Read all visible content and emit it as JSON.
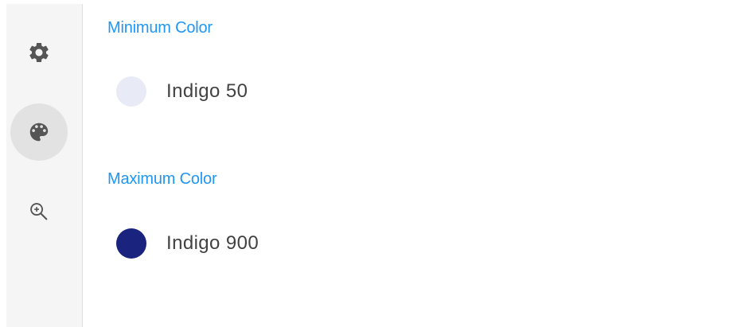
{
  "sidebar": {
    "items": [
      {
        "icon": "gear-icon",
        "selected": false
      },
      {
        "icon": "palette-icon",
        "selected": true
      },
      {
        "icon": "zoom-in-icon",
        "selected": false
      }
    ]
  },
  "min_color": {
    "title": "Minimum Color",
    "name": "Indigo 50",
    "hex": "#e8eaf6"
  },
  "max_color": {
    "title": "Maximum Color",
    "name": "Indigo 900",
    "hex": "#1a237e"
  },
  "colors": {
    "accent": "#2196f3",
    "icon": "#555555",
    "selected_bg": "#e2e2e2"
  }
}
